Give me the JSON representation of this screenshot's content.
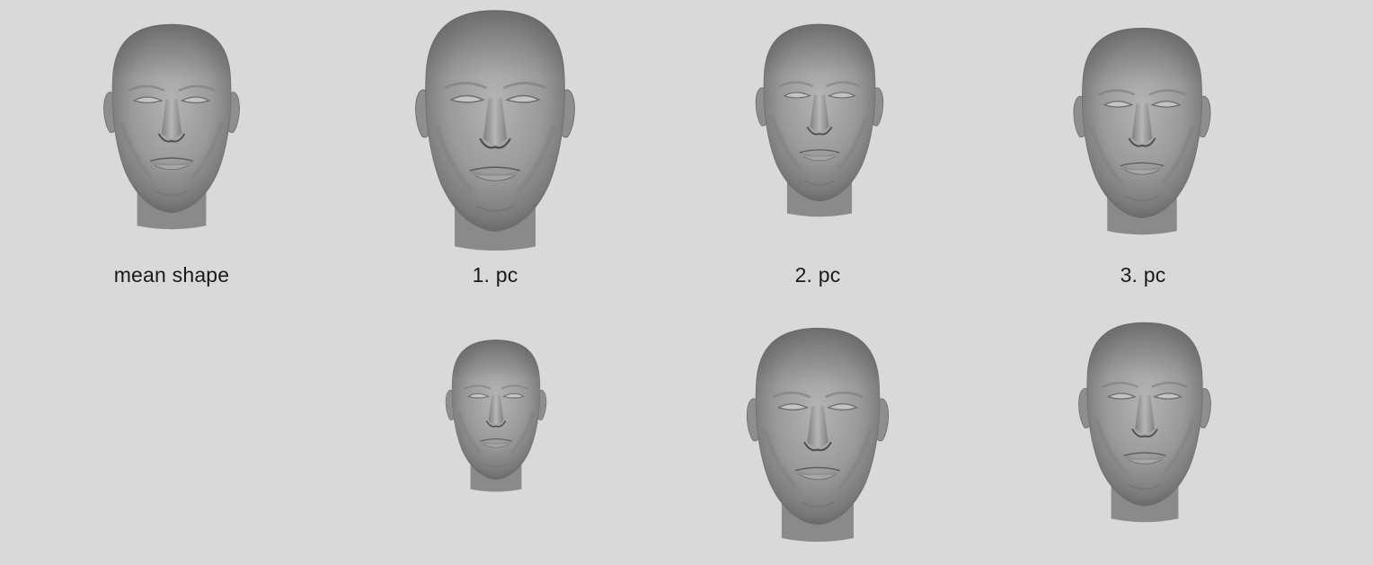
{
  "captions": {
    "mean": "mean shape",
    "pc1": "1. pc",
    "pc2": "2. pc",
    "pc3": "3. pc"
  },
  "faces": [
    {
      "name": "mean-shape-face"
    },
    {
      "name": "pc1-positive-face"
    },
    {
      "name": "pc2-positive-face"
    },
    {
      "name": "pc3-positive-face"
    },
    {
      "name": "pc1-negative-face"
    },
    {
      "name": "pc2-negative-face"
    },
    {
      "name": "pc3-negative-face"
    }
  ],
  "colors": {
    "background": "#d9d9d9",
    "skin_light": "#b4b4b4",
    "skin_mid": "#8f8f8f",
    "skin_dark": "#555555"
  }
}
